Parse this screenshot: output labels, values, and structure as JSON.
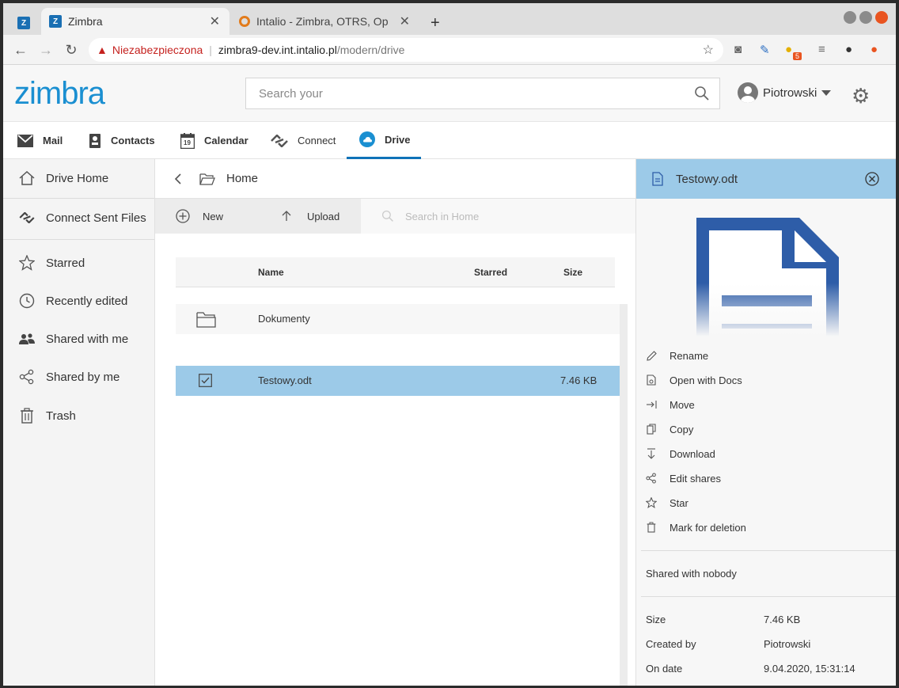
{
  "browser": {
    "tabs": [
      {
        "label": "Zimbra",
        "favicon": "zimbra-favicon",
        "active": true
      },
      {
        "label": "Intalio - Zimbra, OTRS, Op",
        "favicon": "intalio-favicon",
        "active": false
      }
    ],
    "new_tab": "+",
    "insecure_label": "Niezabezpieczona",
    "url_host": "zimbra9-dev.int.intalio.pl",
    "url_path": "/modern/drive",
    "extension_badge": "5"
  },
  "app": {
    "logo": "zimbra",
    "search_placeholder": "Search your",
    "user_name": "Piotrowski"
  },
  "modules": [
    {
      "label": "Mail",
      "icon": "mail-icon"
    },
    {
      "label": "Contacts",
      "icon": "contacts-icon"
    },
    {
      "label": "Calendar",
      "icon": "calendar-icon",
      "calendar_day": "19"
    },
    {
      "label": "Connect",
      "icon": "connect-icon"
    },
    {
      "label": "Drive",
      "icon": "cloud-icon",
      "active": true
    }
  ],
  "sidebar": {
    "items": [
      {
        "label": "Drive Home",
        "icon": "home-icon"
      },
      {
        "label": "Connect Sent Files",
        "icon": "connect-icon"
      },
      {
        "label": "Starred",
        "icon": "star-icon"
      },
      {
        "label": "Recently edited",
        "icon": "clock-icon"
      },
      {
        "label": "Shared with me",
        "icon": "people-icon"
      },
      {
        "label": "Shared by me",
        "icon": "share-icon"
      },
      {
        "label": "Trash",
        "icon": "trash-icon"
      }
    ]
  },
  "center": {
    "breadcrumb": "Home",
    "new_label": "New",
    "upload_label": "Upload",
    "search_placeholder": "Search in Home",
    "columns": {
      "name": "Name",
      "starred": "Starred",
      "size": "Size"
    },
    "rows": [
      {
        "name": "Dokumenty",
        "type": "folder",
        "size": ""
      },
      {
        "name": "Testowy.odt",
        "type": "file",
        "size": "7.46 KB",
        "selected": true
      }
    ]
  },
  "detail": {
    "title": "Testowy.odt",
    "actions": [
      {
        "label": "Rename",
        "icon": "pencil-icon"
      },
      {
        "label": "Open with Docs",
        "icon": "docs-icon"
      },
      {
        "label": "Move",
        "icon": "move-icon"
      },
      {
        "label": "Copy",
        "icon": "copy-icon"
      },
      {
        "label": "Download",
        "icon": "download-icon"
      },
      {
        "label": "Edit shares",
        "icon": "share-icon"
      },
      {
        "label": "Star",
        "icon": "star-icon"
      },
      {
        "label": "Mark for deletion",
        "icon": "trash-icon"
      }
    ],
    "shared_text": "Shared with nobody",
    "info": [
      {
        "key": "Size",
        "value": "7.46 KB"
      },
      {
        "key": "Created by",
        "value": "Piotrowski"
      },
      {
        "key": "On date",
        "value": "9.04.2020, 15:31:14"
      }
    ]
  },
  "colors": {
    "brand": "#1a8fd1",
    "active_tab_underline": "#0f72b8",
    "selection": "#9ccae8",
    "file_icon": "#2e5da8",
    "insecure": "#c5221f"
  }
}
